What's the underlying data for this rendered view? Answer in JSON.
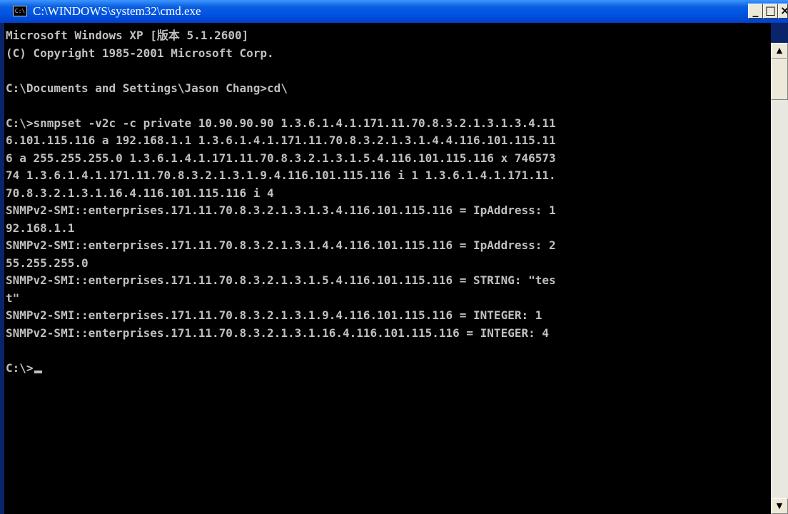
{
  "window": {
    "title": "C:\\WINDOWS\\system32\\cmd.exe",
    "icon_label": "C:\\",
    "minimize_label": "_",
    "maximize_label": "□",
    "close_label": "×"
  },
  "console": {
    "lines": [
      "Microsoft Windows XP [版本 5.1.2600]",
      "(C) Copyright 1985-2001 Microsoft Corp.",
      "",
      "C:\\Documents and Settings\\Jason Chang>cd\\",
      "",
      "C:\\>snmpset -v2c -c private 10.90.90.90 1.3.6.1.4.1.171.11.70.8.3.2.1.3.1.3.4.11",
      "6.101.115.116 a 192.168.1.1 1.3.6.1.4.1.171.11.70.8.3.2.1.3.1.4.4.116.101.115.11",
      "6 a 255.255.255.0 1.3.6.1.4.1.171.11.70.8.3.2.1.3.1.5.4.116.101.115.116 x 746573",
      "74 1.3.6.1.4.1.171.11.70.8.3.2.1.3.1.9.4.116.101.115.116 i 1 1.3.6.1.4.1.171.11.",
      "70.8.3.2.1.3.1.16.4.116.101.115.116 i 4",
      "SNMPv2-SMI::enterprises.171.11.70.8.3.2.1.3.1.3.4.116.101.115.116 = IpAddress: 1",
      "92.168.1.1",
      "SNMPv2-SMI::enterprises.171.11.70.8.3.2.1.3.1.4.4.116.101.115.116 = IpAddress: 2",
      "55.255.255.0",
      "SNMPv2-SMI::enterprises.171.11.70.8.3.2.1.3.1.5.4.116.101.115.116 = STRING: \"tes",
      "t\"",
      "SNMPv2-SMI::enterprises.171.11.70.8.3.2.1.3.1.9.4.116.101.115.116 = INTEGER: 1",
      "SNMPv2-SMI::enterprises.171.11.70.8.3.2.1.3.1.16.4.116.101.115.116 = INTEGER: 4",
      ""
    ],
    "prompt": "C:\\>"
  },
  "scrollbar": {
    "up_arrow_icon": "▲",
    "down_arrow_icon": "▼"
  },
  "colors": {
    "console_background": "#000000",
    "console_text": "#c0c0c0",
    "titlebar": "#0054e3"
  }
}
